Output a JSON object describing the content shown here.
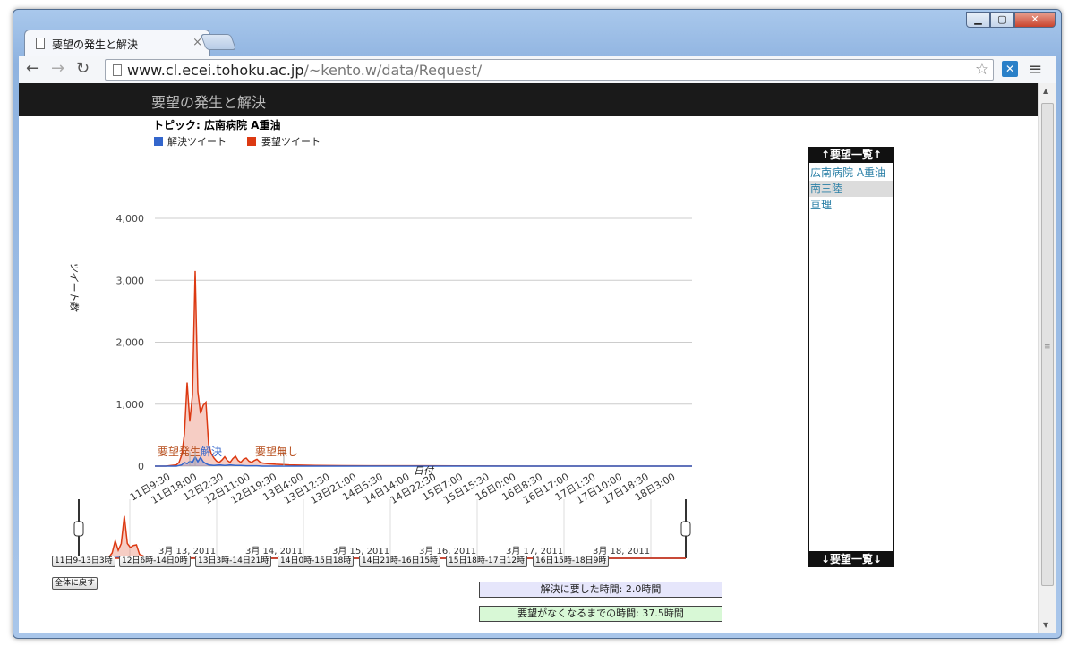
{
  "browser": {
    "tab_title": "要望の発生と解決",
    "tab_close": "×",
    "url_host": "www.cl.ecei.tohoku.ac.jp",
    "url_path": "/~kento.w/data/Request/",
    "back_glyph": "←",
    "forward_glyph": "→",
    "reload_glyph": "↻",
    "star_glyph": "☆",
    "menu_glyph": "≡",
    "min_glyph": "▁",
    "max_glyph": "▢",
    "close_glyph": "✕"
  },
  "page": {
    "header_title": "要望の発生と解決",
    "topic": "トピック: 広南病院 A重油"
  },
  "chart_data": [
    {
      "type": "area",
      "title": "トピック: 広南病院 A重油",
      "xlabel": "日付",
      "ylabel": "ツイート数",
      "ylim": [
        0,
        4000
      ],
      "yticks": [
        0,
        1000,
        2000,
        3000,
        4000
      ],
      "ytick_labels": [
        "0",
        "1,000",
        "2,000",
        "3,000",
        "4,000"
      ],
      "grid": true,
      "legend_placement": "top-left",
      "x_tick_labels": [
        "11日9:30",
        "11日18:00",
        "12日2:30",
        "12日11:00",
        "12日19:30",
        "13日4:00",
        "13日12:30",
        "13日21:00",
        "14日5:30",
        "14日14:00",
        "14日22:30",
        "15日7:00",
        "15日15:30",
        "16日0:00",
        "16日8:30",
        "16日17:00",
        "17日1:30",
        "17日10:00",
        "17日18:30",
        "18日3:00"
      ],
      "series": [
        {
          "name": "解決ツイート",
          "color": "#3366cc",
          "x": [
            0,
            8,
            9,
            10,
            11,
            12,
            13,
            14,
            15,
            16,
            17,
            18,
            19,
            20,
            22,
            24,
            26,
            28,
            30,
            32,
            34,
            36,
            38,
            40,
            45,
            50,
            60,
            80,
            100,
            140,
            200
          ],
          "values": [
            0,
            0,
            10,
            20,
            60,
            40,
            80,
            60,
            150,
            70,
            140,
            70,
            40,
            20,
            10,
            20,
            10,
            20,
            10,
            10,
            5,
            5,
            5,
            0,
            0,
            0,
            0,
            0,
            0,
            0,
            0
          ]
        },
        {
          "name": "要望ツイート",
          "color": "#dc3912",
          "x": [
            0,
            4,
            8,
            9,
            10,
            11,
            12,
            13,
            14,
            15,
            16,
            17,
            18,
            19,
            20,
            21,
            22,
            23,
            24,
            25,
            26,
            27,
            28,
            29,
            30,
            31,
            32,
            33,
            34,
            35,
            36,
            37,
            38,
            39,
            40,
            42,
            45,
            50,
            60,
            80,
            100,
            140,
            200
          ],
          "values": [
            0,
            0,
            20,
            60,
            180,
            520,
            1350,
            720,
            1150,
            3150,
            1200,
            850,
            980,
            1030,
            350,
            200,
            130,
            80,
            60,
            100,
            150,
            90,
            60,
            120,
            160,
            90,
            60,
            110,
            130,
            80,
            60,
            90,
            110,
            70,
            50,
            40,
            30,
            20,
            10,
            5,
            5,
            0,
            0
          ]
        }
      ],
      "annotations": [
        {
          "text": "要望発生",
          "color": "#b8501f",
          "x": 13
        },
        {
          "text": "解決",
          "color": "#3366cc",
          "x": 15
        },
        {
          "text": "要望無し",
          "color": "#b8501f",
          "x": 42
        }
      ]
    },
    {
      "type": "area",
      "title": "",
      "x_tick_labels": [
        "3月 13, 2011",
        "3月 14, 2011",
        "3月 15, 2011",
        "3月 16, 2011",
        "3月 17, 2011",
        "3月 18, 2011"
      ],
      "series": [
        {
          "name": "要望ツイート",
          "color": "#dc3912",
          "x": [
            0,
            5,
            10,
            11,
            12,
            13,
            14,
            15,
            16,
            17,
            18,
            19,
            20,
            22,
            25,
            30,
            40,
            50,
            60,
            80,
            100,
            150,
            200
          ],
          "values": [
            0,
            0,
            100,
            400,
            1300,
            600,
            1100,
            3150,
            1100,
            800,
            950,
            1000,
            300,
            100,
            60,
            40,
            20,
            10,
            5,
            0,
            0,
            0,
            0
          ]
        },
        {
          "name": "解決ツイート",
          "color": "#3366cc",
          "x": [
            0,
            12,
            13,
            14,
            15,
            16,
            17,
            18,
            20,
            30,
            200
          ],
          "values": [
            0,
            40,
            60,
            50,
            140,
            60,
            100,
            40,
            10,
            0,
            0
          ]
        }
      ]
    }
  ],
  "range_buttons": [
    "11日9-13日3時",
    "12日6時-14日0時",
    "13日3時-14日21時",
    "14日0時-15日18時",
    "14日21時-16日15時",
    "15日18時-17日12時",
    "16日15時-18日9時"
  ],
  "reset_button": "全体に戻す",
  "info": {
    "resolve_time": "解決に要した時間: 2.0時間",
    "no_request_time": "要望がなくなるまでの時間: 37.5時間"
  },
  "request_panel": {
    "header": "↑要望一覧↑",
    "footer": "↓要望一覧↓",
    "items": [
      {
        "label": "広南病院 A重油",
        "selected": false
      },
      {
        "label": "南三陸",
        "selected": true
      },
      {
        "label": "亘理",
        "selected": false
      }
    ]
  }
}
